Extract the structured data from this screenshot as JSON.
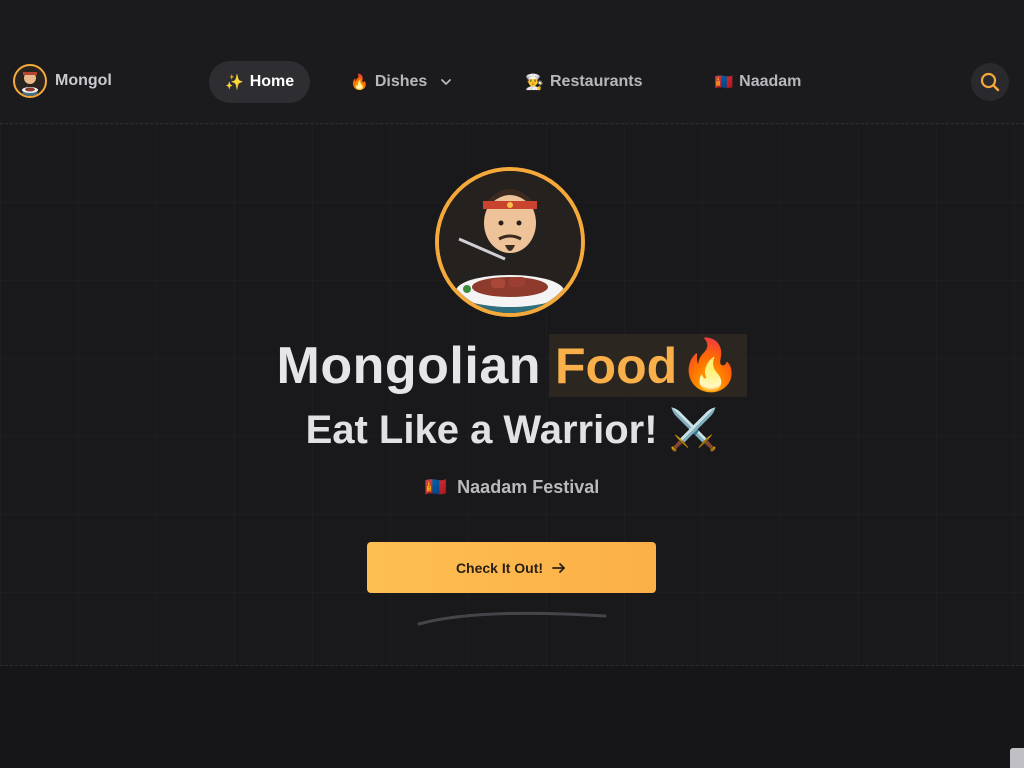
{
  "brand": {
    "name": "Mongol"
  },
  "nav": {
    "items": [
      {
        "icon": "✨",
        "label": "Home",
        "active": true
      },
      {
        "icon": "🔥",
        "label": "Dishes",
        "dropdown": true
      },
      {
        "icon": "👨‍🍳",
        "label": "Restaurants"
      },
      {
        "icon": "🇲🇳",
        "label": "Naadam"
      }
    ],
    "search_icon": "search-icon"
  },
  "hero": {
    "title_main": "Mongolian",
    "title_highlight": "Food",
    "title_emoji": "🔥",
    "subtitle": "Eat Like a Warrior! ⚔️",
    "badge_flag": "🇲🇳",
    "badge_text": "Naadam Festival",
    "cta_label": "Check It Out!"
  },
  "colors": {
    "accent": "#f9b04a",
    "background": "#1b1b1e",
    "cta_start": "#fdbe52",
    "cta_end": "#fcb047"
  }
}
